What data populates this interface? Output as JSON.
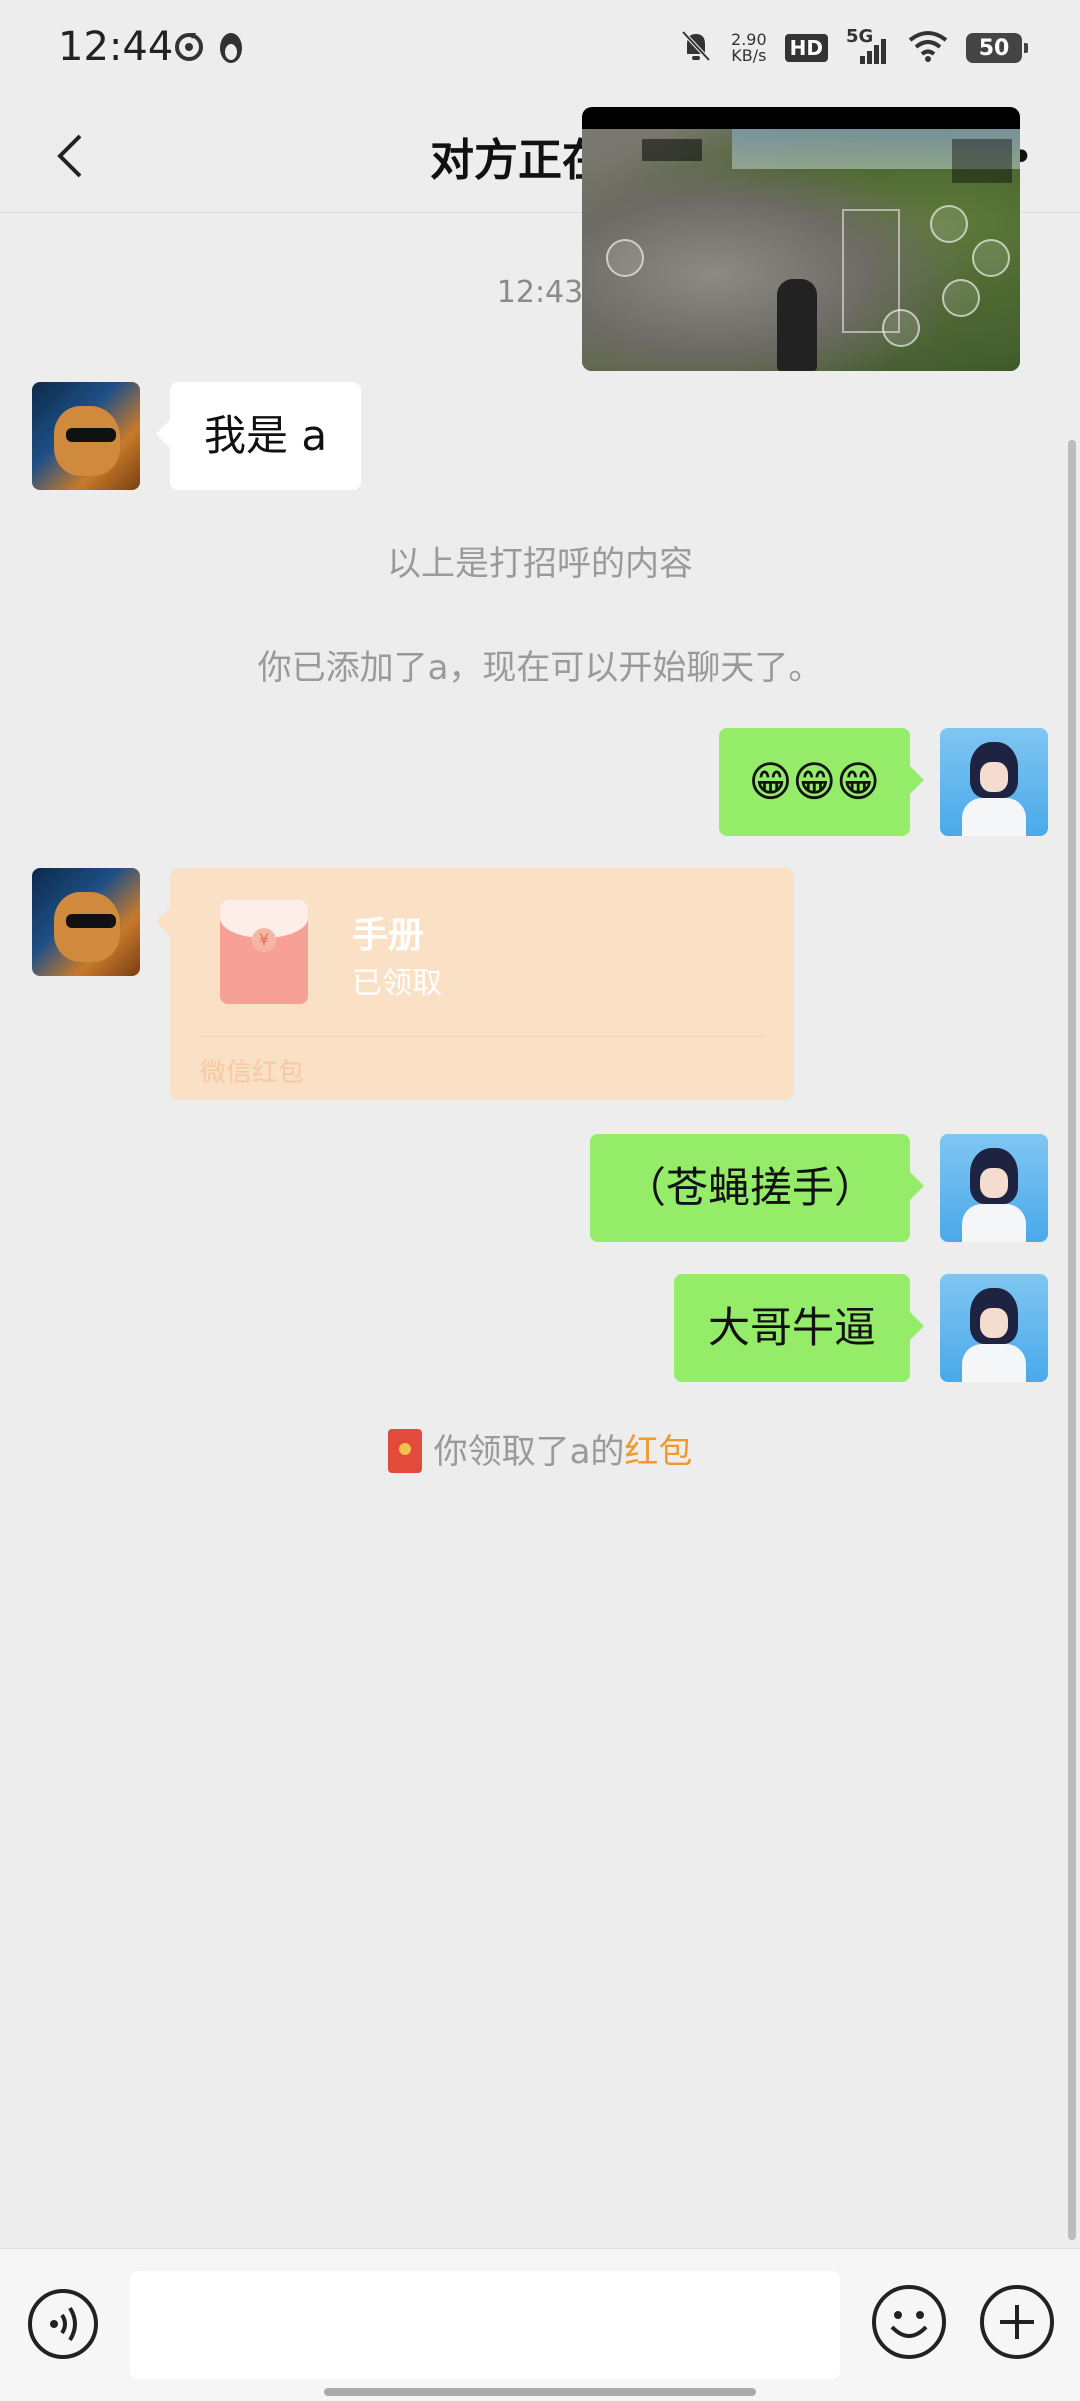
{
  "status_bar": {
    "time": "12:44",
    "net_speed_value": "2.90",
    "net_speed_unit": "KB/s",
    "hd": "HD",
    "network": "5G",
    "battery": "50"
  },
  "header": {
    "title": "对方正在输",
    "more": "•"
  },
  "chat": {
    "timestamp": "12:43",
    "msg_hello": "我是 a",
    "sys_greeting": "以上是打招呼的内容",
    "sys_added": "你已添加了a，现在可以开始聊天了。",
    "msg_emoji": "😁😁😁",
    "red_packet": {
      "title": "手册",
      "status": "已领取",
      "footer": "微信红包",
      "coin": "¥"
    },
    "msg_rub_hands": "（苍蝇搓手）",
    "msg_big_brother": "大哥牛逼",
    "received_prefix": "你领取了a的",
    "received_highlight": "红包"
  },
  "input": {
    "placeholder": ""
  },
  "colors": {
    "accent_green": "#95ec69",
    "red_packet_bg": "#fae0c4",
    "highlight_orange": "#f09a2c",
    "background": "#ededed"
  }
}
